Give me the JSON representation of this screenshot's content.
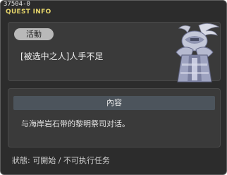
{
  "window": {
    "id_label": "37504-0",
    "title": "QUEST INFO"
  },
  "quest": {
    "category_tag": "活動",
    "name": "[被选中之人]人手不足",
    "portrait_icon": "armored-npc-portrait-icon"
  },
  "content": {
    "header": "內容",
    "text": "与海岸岩石带的黎明祭司对话。"
  },
  "status": {
    "label": "狀態:",
    "value": "可開始 / 不可执行任务"
  },
  "colors": {
    "title": "#e6d56a",
    "window_bg": "#2c2c2c",
    "panel_bg": "#3a3a3a",
    "section_bar": "#4c545c",
    "pill_bg": "#b9b9b9"
  }
}
